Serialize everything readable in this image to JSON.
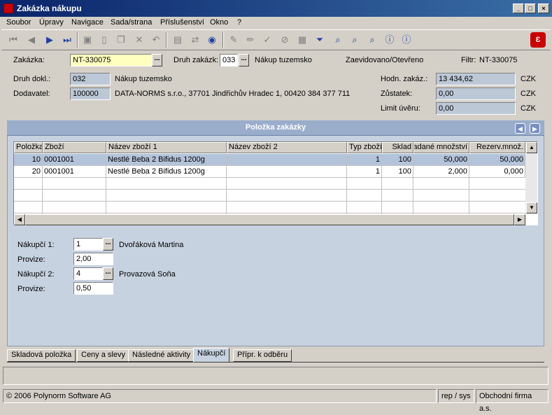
{
  "window": {
    "title": "Zakázka nákupu",
    "minimize": "_",
    "maximize": "□",
    "close": "×"
  },
  "menu": [
    {
      "label": "Soubor"
    },
    {
      "label": "Úpravy"
    },
    {
      "label": "Navigace"
    },
    {
      "label": "Sada/strana"
    },
    {
      "label": "Příslušenství"
    },
    {
      "label": "Okno"
    },
    {
      "label": "?"
    }
  ],
  "toolbar": {
    "icons": [
      "first-record-icon",
      "previous-record-icon",
      "next-record-icon",
      "last-record-icon",
      "save-icon",
      "new-icon",
      "copy-icon",
      "delete-icon",
      "undo-icon",
      "print-icon",
      "export-icon",
      "globe-icon",
      "edit-icon",
      "pencil-icon",
      "check-icon",
      "filter-off-icon",
      "calculator-icon",
      "filter-icon",
      "search-icon",
      "zoom-icon",
      "find-icon",
      "info-icon",
      "help-icon"
    ]
  },
  "header": {
    "zakazka_label": "Zakázka:",
    "zakazka_value": "NT-330075",
    "druh_zakazk_label": "Druh zakázk:",
    "druh_zakazk_value": "033",
    "druh_zakazk_text": "Nákup tuzemsko",
    "state": "Zaevidovano/Otevřeno",
    "filter_label": "Filtr:",
    "filter_value": "NT-330075",
    "druh_dokl_label": "Druh dokl.:",
    "druh_dokl_value": "032",
    "druh_dokl_text": "Nákup tuzemsko",
    "dodavatel_label": "Dodavatel:",
    "dodavatel_value": "100000",
    "dodavatel_text": "DATA-NORMS s.r.o., 37701 Jindřichův Hradec 1, 00420 384 377 711",
    "hodn_label": "Hodn. zakáz.:",
    "hodn_value": "13 434,62",
    "hodn_cur": "CZK",
    "zustatek_label": "Zůstatek:",
    "zustatek_value": "0,00",
    "zustatek_cur": "CZK",
    "limit_label": "Limit úvěru:",
    "limit_value": "0,00",
    "limit_cur": "CZK"
  },
  "panel": {
    "title": "Položka zakázky",
    "prev": "◀",
    "next": "▶"
  },
  "grid": {
    "columns": [
      "Položka",
      "Zboží",
      "Název zboží 1",
      "Název zboží 2",
      "Typ zboží",
      "Sklad",
      "Zadané množství",
      "Rezerv.množ."
    ],
    "rows": [
      [
        "10",
        "0001001",
        "Nestlé Beba 2 Bifidus 1200g",
        "",
        "1",
        "100",
        "50,000",
        "50,000"
      ],
      [
        "20",
        "0001001",
        "Nestlé Beba 2 Bifidus 1200g",
        "",
        "1",
        "100",
        "2,000",
        "0,000"
      ]
    ]
  },
  "detail": {
    "nakupci1_label": "Nákupčí 1:",
    "nakupci1_value": "1",
    "nakupci1_name": "Dvořáková Martina",
    "provize1_label": "Provize:",
    "provize1_value": "2,00",
    "nakupci2_label": "Nákupčí 2:",
    "nakupci2_value": "4",
    "nakupci2_name": "Provazová Soňa",
    "provize2_label": "Provize:",
    "provize2_value": "0,50"
  },
  "tabs": [
    {
      "label": "Skladová položka"
    },
    {
      "label": "Ceny a slevy"
    },
    {
      "label": "Následné aktivity"
    },
    {
      "label": "Nákupčí"
    },
    {
      "label": "Přípr. k odběru"
    }
  ],
  "status": {
    "copyright": "© 2006 Polynorm Software AG",
    "user": "rep / sys",
    "company": "Obchodní firma a.s."
  },
  "colors": {
    "titlebar": "#0a246a",
    "panel": "#c6d2e0",
    "selected_row": "#b3c3da",
    "readonly_field": "#bcc8d6",
    "active_field": "#ffffc0"
  }
}
